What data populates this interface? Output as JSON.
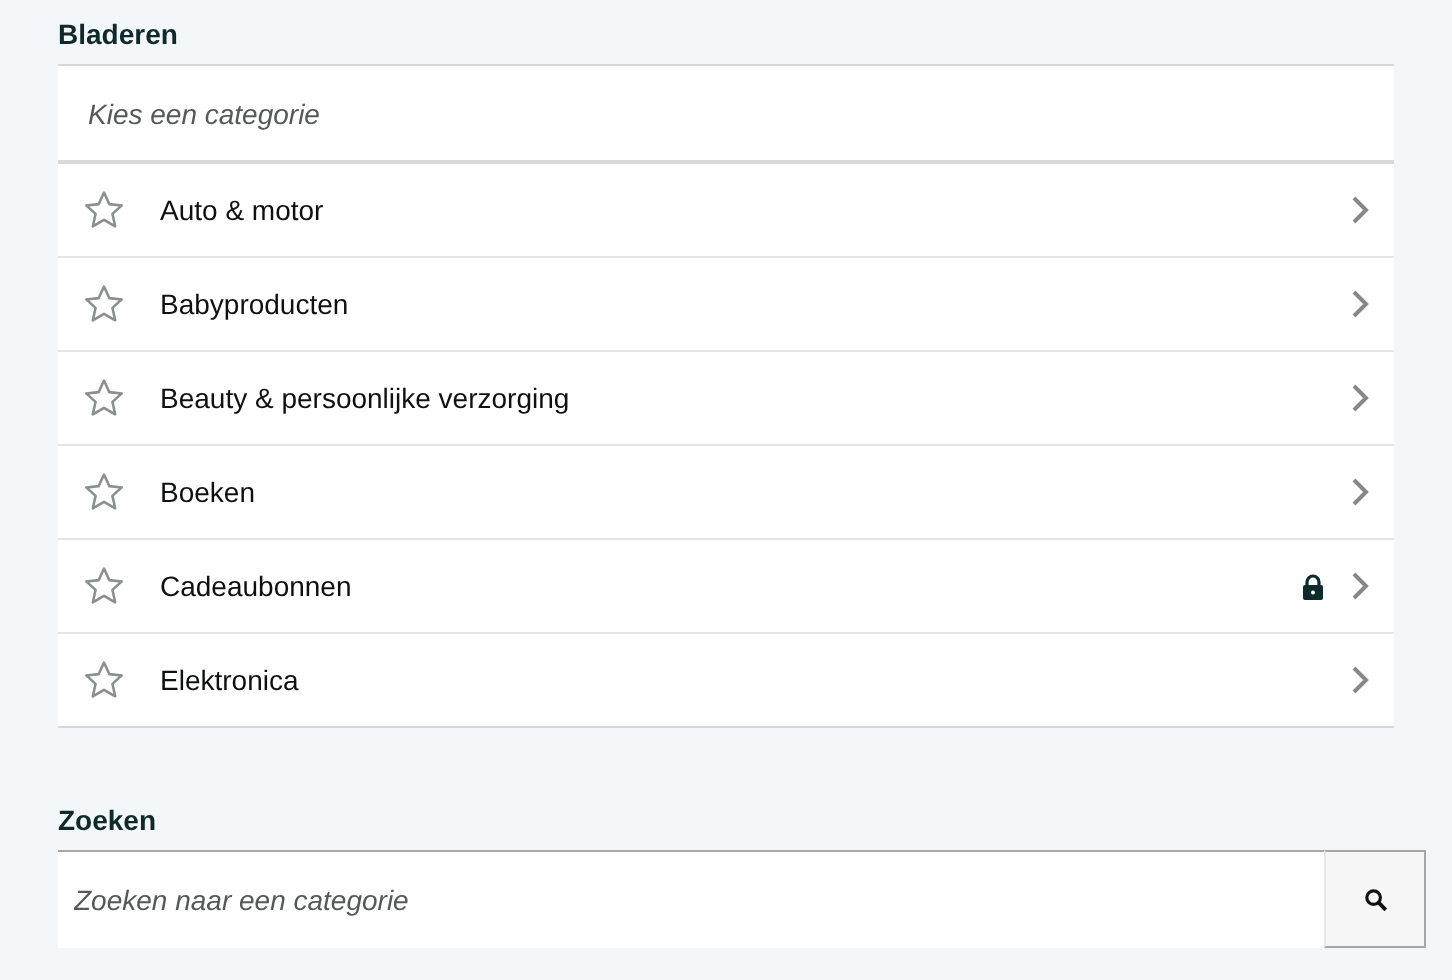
{
  "browse": {
    "heading": "Bladeren",
    "subtitle": "Kies een categorie",
    "categories": [
      {
        "label": "Auto & motor",
        "starred": false,
        "locked": false
      },
      {
        "label": "Babyproducten",
        "starred": false,
        "locked": false
      },
      {
        "label": "Beauty & persoonlijke verzorging",
        "starred": false,
        "locked": false
      },
      {
        "label": "Boeken",
        "starred": false,
        "locked": false
      },
      {
        "label": "Cadeaubonnen",
        "starred": false,
        "locked": true
      },
      {
        "label": "Elektronica",
        "starred": false,
        "locked": false
      }
    ]
  },
  "search": {
    "heading": "Zoeken",
    "placeholder": "Zoeken naar een categorie"
  }
}
